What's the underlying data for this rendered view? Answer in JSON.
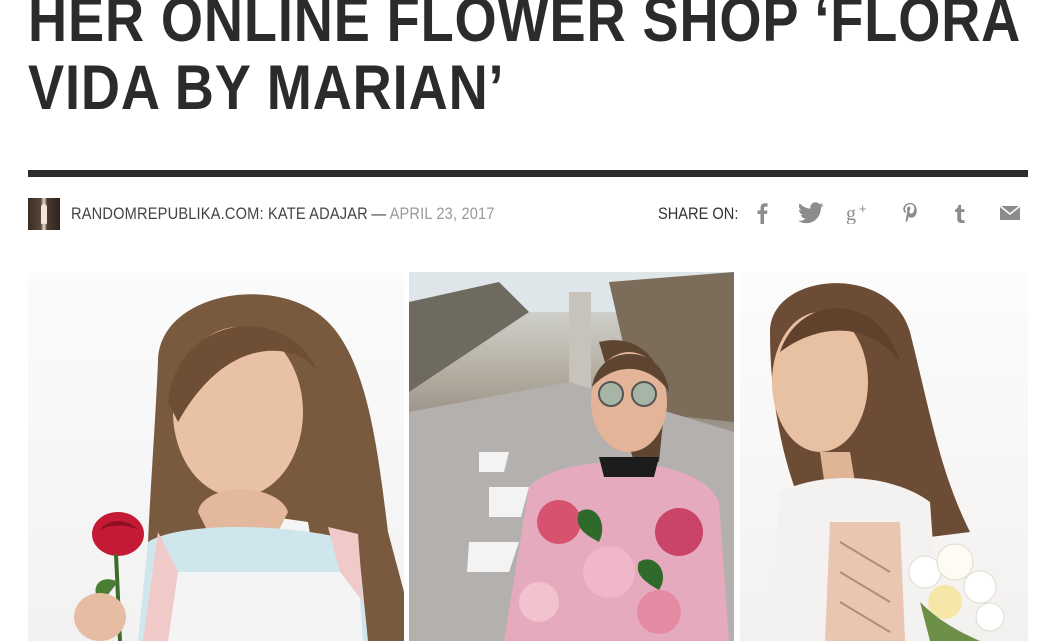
{
  "article": {
    "headline_line1": "HER ONLINE FLOWER SHOP ‘FLORA",
    "headline_line2": "VIDA BY MARIAN’"
  },
  "meta": {
    "author": "RANDOMREPUBLIKA.COM: KATE ADAJAR",
    "separator": "—",
    "date": "APRIL 23, 2017"
  },
  "share": {
    "label": "SHARE ON:",
    "icons": [
      "facebook-icon",
      "twitter-icon",
      "google-plus-icon",
      "pinterest-icon",
      "tumblr-icon",
      "email-icon"
    ]
  },
  "colors": {
    "headline": "#2b2b2b",
    "rule": "#2d2d2d",
    "date": "#9a9a9a",
    "icon": "#8c8c8c"
  }
}
